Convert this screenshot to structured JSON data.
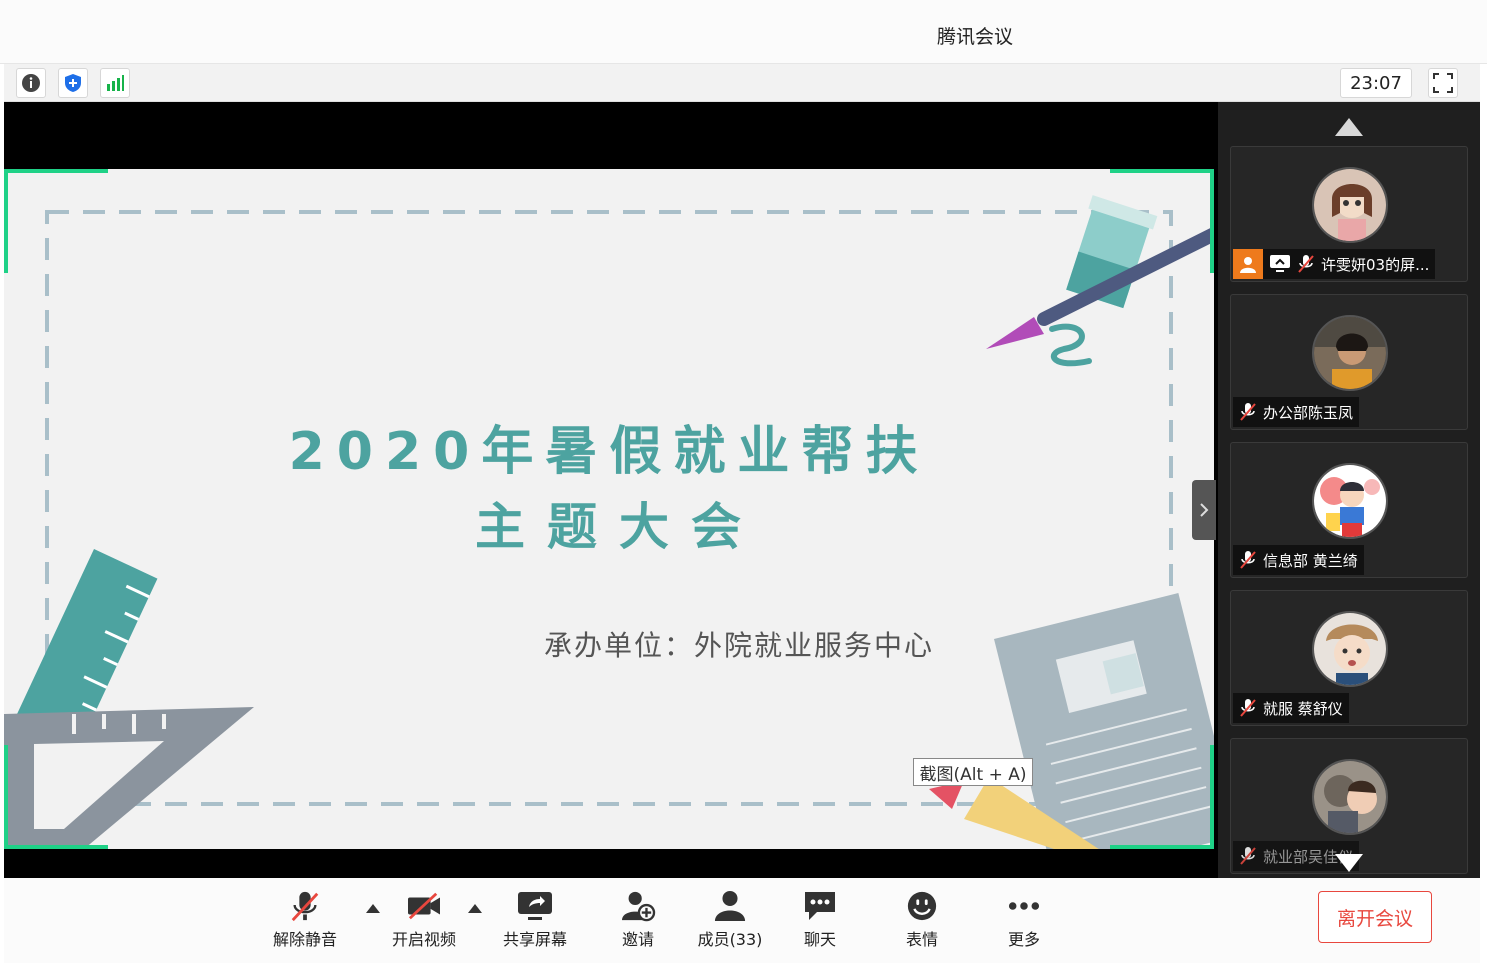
{
  "window": {
    "title": "腾讯会议"
  },
  "toolbar": {
    "info_icon": "info-icon",
    "security_icon": "shield-icon",
    "signal_icon": "signal-icon",
    "timer": "23:07",
    "fullscreen_icon": "fullscreen-icon"
  },
  "slide": {
    "title_line1": "2020年暑假就业帮扶",
    "title_line2": "主题大会",
    "organizer": "承办单位：外院就业服务中心",
    "screenshot_tip": "截图(Alt + A)"
  },
  "participants": [
    {
      "name": "许雯妍03的屏...",
      "sharing": true
    },
    {
      "name": "办公部陈玉凤",
      "sharing": false
    },
    {
      "name": "信息部 黄兰绮",
      "sharing": false
    },
    {
      "name": "就服 蔡舒仪",
      "sharing": false
    },
    {
      "name": "就业部吴佳仪",
      "sharing": false
    }
  ],
  "bottombar": {
    "unmute": "解除静音",
    "start_video": "开启视频",
    "share_screen": "共享屏幕",
    "invite": "邀请",
    "members": "成员(33)",
    "chat": "聊天",
    "reactions": "表情",
    "more": "更多",
    "leave": "离开会议"
  },
  "colors": {
    "accent_green": "#1fd187",
    "slide_title": "#4da3a0",
    "leave_red": "#e8473e"
  }
}
